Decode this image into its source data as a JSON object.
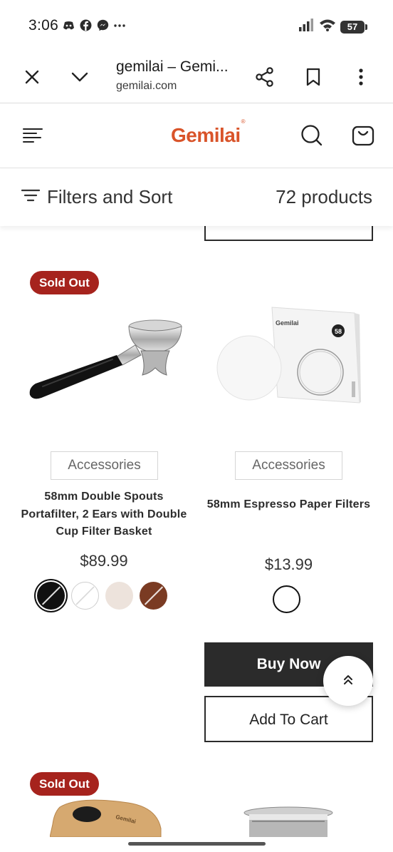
{
  "status_bar": {
    "time": "3:06",
    "notification_icons": [
      "discord-icon",
      "facebook-icon",
      "messenger-icon",
      "more-dots-icon"
    ],
    "battery_level": "57"
  },
  "browser": {
    "page_title": "gemilai – Gemi...",
    "url": "gemilai.com"
  },
  "site_header": {
    "logo_text": "Gemilai",
    "logo_mark": "®",
    "brand_color": "#d9542a"
  },
  "filters": {
    "label": "Filters and Sort",
    "product_count": "72 products"
  },
  "products": [
    {
      "badge": "Sold Out",
      "category": "Accessories",
      "name": "58mm Double Spouts Portafilter, 2 Ears with Double Cup Filter Basket",
      "price": "$89.99",
      "swatches": [
        {
          "color": "#111111",
          "selected": true,
          "label": "black"
        },
        {
          "color": "#ffffff",
          "selected": false,
          "label": "white"
        },
        {
          "color": "#ede3dc",
          "selected": false,
          "label": "cream"
        },
        {
          "color": "#7a3b23",
          "selected": false,
          "label": "walnut"
        }
      ]
    },
    {
      "badge": "",
      "category": "Accessories",
      "name": "58mm Espresso Paper Filters",
      "price": "$13.99",
      "box_brand": "Gemilai",
      "box_size": "58",
      "swatches": [
        {
          "color": "#ffffff",
          "selected": false,
          "label": "white"
        }
      ],
      "buy_now": "Buy Now",
      "add_to_cart": "Add To Cart"
    },
    {
      "badge": "Sold Out",
      "brand_on_product": "Gemilai"
    }
  ],
  "colors": {
    "sold_out_badge": "#a6231d",
    "buy_button": "#2b2b2b"
  }
}
